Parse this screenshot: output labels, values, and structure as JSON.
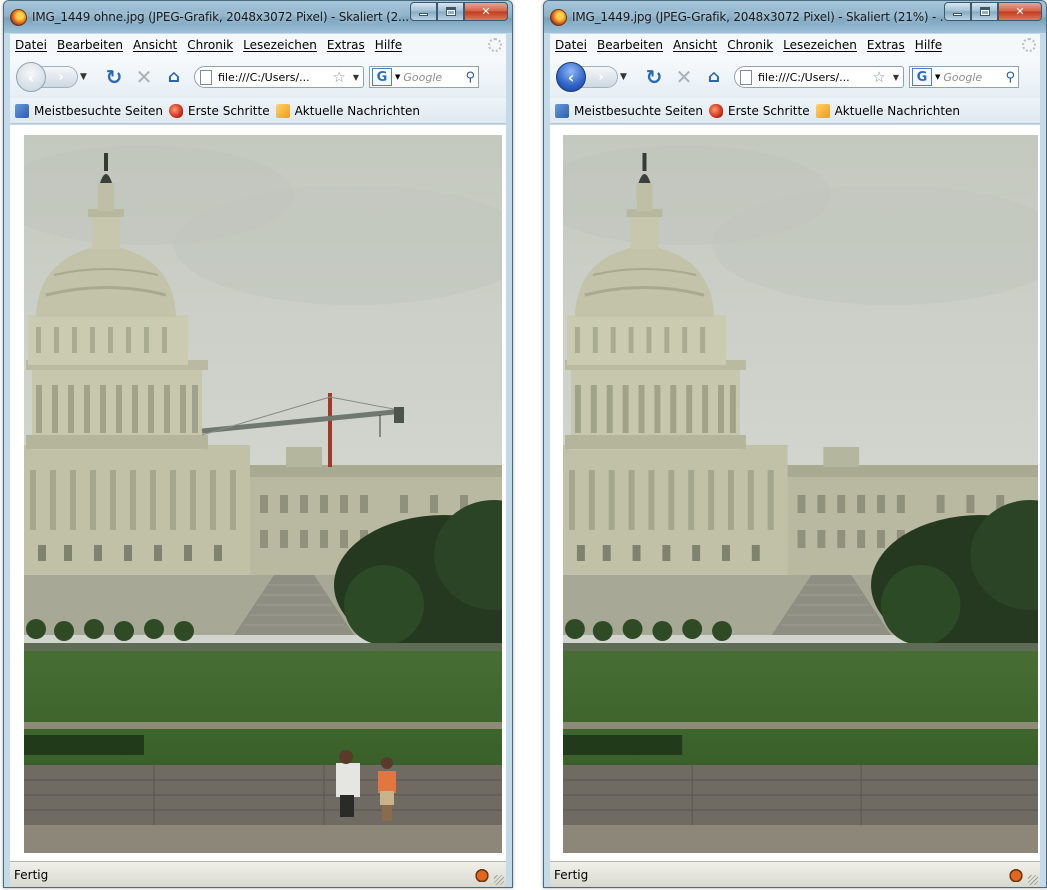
{
  "windows": [
    {
      "title": "IMG_1449 ohne.jpg (JPEG-Grafik, 2048x3072 Pixel) - Skaliert (2...",
      "url": "file:///C:/Users/...",
      "status": "Fertig",
      "back_enabled": false,
      "photo_shows_crane": true,
      "photo_shows_people": true
    },
    {
      "title": "IMG_1449.jpg (JPEG-Grafik, 2048x3072 Pixel) - Skaliert (21%) - ...",
      "url": "file:///C:/Users/...",
      "status": "Fertig",
      "back_enabled": true,
      "photo_shows_crane": false,
      "photo_shows_people": false
    }
  ],
  "menu": {
    "items": [
      "Datei",
      "Bearbeiten",
      "Ansicht",
      "Chronik",
      "Lesezeichen",
      "Extras",
      "Hilfe"
    ]
  },
  "search": {
    "placeholder": "Google"
  },
  "bookmarks": {
    "items": [
      "Meistbesuchte Seiten",
      "Erste Schritte",
      "Aktuelle Nachrichten"
    ]
  },
  "icons": {
    "back": "back-arrow-icon",
    "forward": "forward-arrow-icon",
    "reload": "reload-icon",
    "stop": "stop-icon",
    "home": "home-icon",
    "bookmark_star": "star-icon",
    "search_engine": "google-icon",
    "search": "magnifier-icon",
    "status_addon": "bug-icon"
  },
  "colors": {
    "titlebar": "#8fb3cb",
    "close_button": "#c4391b",
    "back_button_active": "#2e63c8",
    "sky": "#cfd3cb",
    "lawn": "#3f6a2c"
  }
}
